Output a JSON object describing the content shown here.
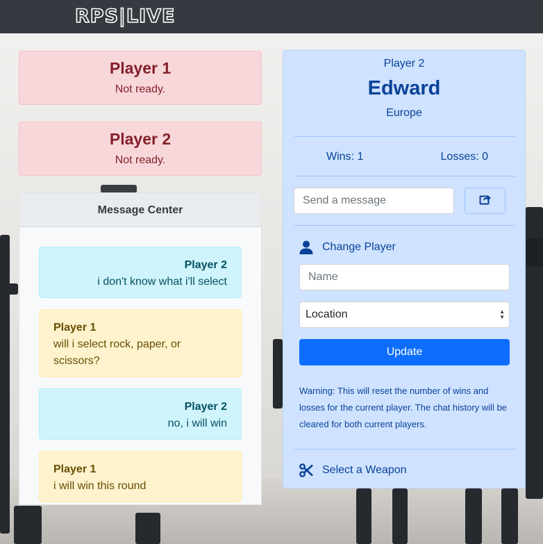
{
  "brand": "RPS|LIVE",
  "player1_status": {
    "name": "Player 1",
    "status": "Not ready."
  },
  "player2_status": {
    "name": "Player 2",
    "status": "Not ready."
  },
  "message_center": {
    "title": "Message Center",
    "messages": [
      {
        "sender": "Player 2",
        "text": "i don't know what i'll select"
      },
      {
        "sender": "Player 1",
        "text": "will i select rock, paper, or scissors?"
      },
      {
        "sender": "Player 2",
        "text": "no, i will win"
      },
      {
        "sender": "Player 1",
        "text": "i will win this round"
      }
    ]
  },
  "panel": {
    "label": "Player 2",
    "name": "Edward",
    "location": "Europe",
    "wins": "Wins: 1",
    "losses": "Losses: 0",
    "message_placeholder": "Send a message",
    "send_icon": "share-icon",
    "change_player": {
      "icon": "user-icon",
      "title": "Change Player"
    },
    "name_placeholder": "Name",
    "location_select": "Location",
    "update_label": "Update",
    "warning": "Warning: This will reset the number of wins and losses for the current player. The chat history will be cleared for both current players.",
    "weapon": {
      "icon": "scissors-icon",
      "title": "Select a Weapon"
    }
  },
  "colors": {
    "navbar": "#343a40",
    "danger_bg": "#f8d7da",
    "danger_text": "#842029",
    "info_bg": "#cff4fc",
    "warning_bg": "#fff3cd",
    "primary_bg": "#cfe2ff",
    "primary_text": "#084298",
    "primary_button": "#0d6efd"
  }
}
